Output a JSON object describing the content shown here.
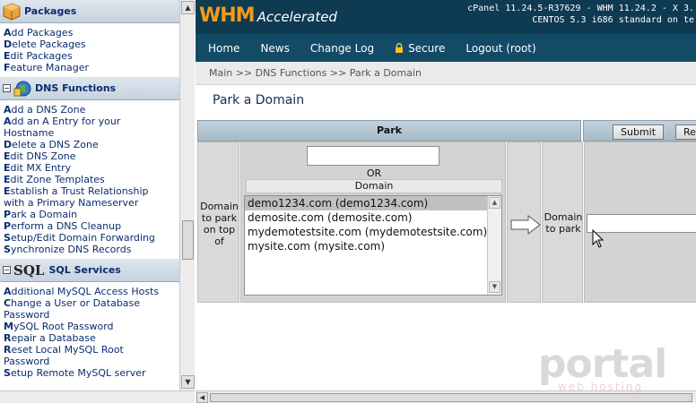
{
  "sidebar": {
    "packages": {
      "title": "Packages",
      "items": [
        {
          "k": "A",
          "rest": "dd Packages"
        },
        {
          "k": "D",
          "rest": "elete Packages"
        },
        {
          "k": "E",
          "rest": "dit Packages"
        },
        {
          "k": "F",
          "rest": "eature Manager"
        }
      ]
    },
    "dns": {
      "title": "DNS Functions",
      "items": [
        {
          "k": "A",
          "rest": "dd a DNS Zone"
        },
        {
          "k": "A",
          "rest": "dd an A Entry for your"
        },
        {
          "k": "",
          "rest": "Hostname"
        },
        {
          "k": "D",
          "rest": "elete a DNS Zone"
        },
        {
          "k": "E",
          "rest": "dit DNS Zone"
        },
        {
          "k": "E",
          "rest": "dit MX Entry"
        },
        {
          "k": "E",
          "rest": "dit Zone Templates"
        },
        {
          "k": "E",
          "rest": "stablish a Trust Relationship"
        },
        {
          "k": "",
          "rest": "with a Primary Nameserver"
        },
        {
          "k": "P",
          "rest": "ark a Domain"
        },
        {
          "k": "P",
          "rest": "erform a DNS Cleanup"
        },
        {
          "k": "S",
          "rest": "etup/Edit Domain Forwarding"
        },
        {
          "k": "S",
          "rest": "ynchronize DNS Records"
        }
      ]
    },
    "sql": {
      "logo_text": "SQL",
      "title": "SQL Services",
      "items": [
        {
          "k": "A",
          "rest": "dditional MySQL Access Hosts"
        },
        {
          "k": "C",
          "rest": "hange a User or Database"
        },
        {
          "k": "",
          "rest": "Password"
        },
        {
          "k": "M",
          "rest": "ySQL Root Password"
        },
        {
          "k": "R",
          "rest": "epair a Database"
        },
        {
          "k": "R",
          "rest": "eset Local MySQL Root"
        },
        {
          "k": "",
          "rest": "Password"
        },
        {
          "k": "S",
          "rest": "etup Remote MySQL server"
        }
      ]
    }
  },
  "header": {
    "logo_whm": "WHM",
    "logo_acc": "Accelerated",
    "version_line1": "cPanel 11.24.5-R37629 - WHM 11.24.2 - X 3.",
    "version_line2": "CENTOS 5.3 i686 standard on te"
  },
  "nav": {
    "items": [
      "Home",
      "News",
      "Change Log",
      "Secure",
      "Logout (root)"
    ]
  },
  "breadcrumb": "Main >> DNS Functions >> Park a Domain",
  "page_title": "Park a Domain",
  "park": {
    "header": "Park",
    "submit_label": "Submit",
    "reset_label": "Re",
    "domain_park_on_top_label": "Domain to park on top of",
    "or_label": "OR",
    "domain_label": "Domain",
    "domain_input_value": "",
    "domains": [
      "demo1234.com (demo1234.com)",
      "demosite.com (demosite.com)",
      "mydemotestsite.com (mydemotestsite.com)",
      "mysite.com (mysite.com)"
    ],
    "selected_index": 0,
    "domain_to_park_label": "Domain to park",
    "domain_to_park_value": ""
  },
  "watermark": {
    "brand": "portal",
    "tagline": "web hosting"
  },
  "colors": {
    "topbar": "#0e3a52",
    "nav": "#134a66",
    "logo_orange": "#f39c1a"
  }
}
